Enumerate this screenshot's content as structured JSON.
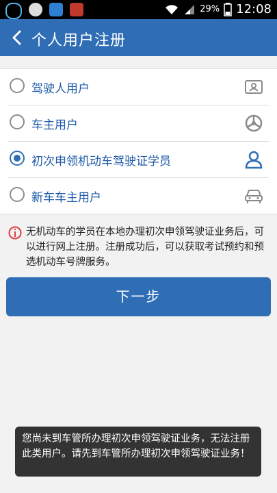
{
  "status_bar": {
    "battery_percent": "29%",
    "time": "12:08",
    "icons": [
      "cloud-icon",
      "wechat-icon",
      "bus-icon",
      "bull-icon",
      "wifi-icon",
      "signal-icon",
      "battery-icon"
    ]
  },
  "header": {
    "title": "个人用户注册",
    "back_icon": "back-arrow-icon"
  },
  "options": [
    {
      "label": "驾驶人用户",
      "icon": "id-card-icon",
      "selected": false
    },
    {
      "label": "车主用户",
      "icon": "steering-wheel-icon",
      "selected": false
    },
    {
      "label": "初次申领机动车驾驶证学员",
      "icon": "person-icon",
      "selected": true
    },
    {
      "label": "新车车主用户",
      "icon": "car-icon",
      "selected": false
    }
  ],
  "notice": {
    "icon": "info-icon",
    "text": "无机动车的学员在本地办理初次申领驾驶证业务后，可以进行网上注册。注册成功后，可以获取考试预约和预选机动车号牌服务。"
  },
  "next_button": {
    "label": "下一步"
  },
  "toast": {
    "text": "您尚未到车管所办理初次申领驾驶证业务，无法注册此类用户。请先到车管所办理初次申领驾驶证业务！"
  },
  "colors": {
    "primary": "#2f6db5",
    "notice_red": "#e23b3b"
  }
}
